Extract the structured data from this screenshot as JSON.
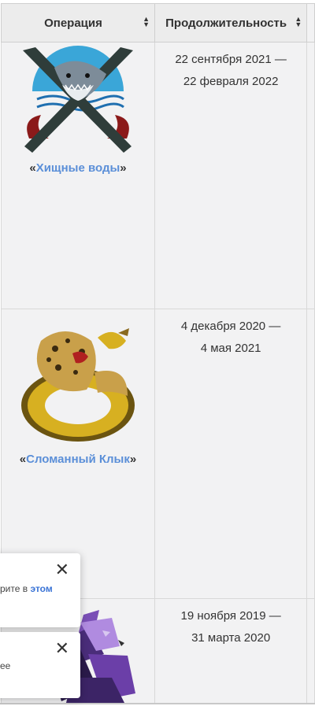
{
  "table": {
    "headers": [
      "Операция",
      "Продолжительность"
    ],
    "rows": [
      {
        "prefix": "«",
        "name": "Хищные воды",
        "suffix": "»",
        "duration_start": "22 сентября 2021 —",
        "duration_end": "22 февраля 2022",
        "icon": "shark-crossed-knives-emblem"
      },
      {
        "prefix": "«",
        "name": "Сломанный Клык",
        "suffix": "»",
        "duration_start": "4 декабря 2020 —",
        "duration_end": "4 мая 2021",
        "icon": "leopard-snake-emblem"
      },
      {
        "prefix": "",
        "name": "",
        "suffix": "",
        "duration_start": "19 ноября 2019 —",
        "duration_end": "31 марта 2020",
        "icon": "shattered-emblem"
      }
    ]
  },
  "toasts": [
    {
      "text": "рите в ",
      "link": "этом"
    },
    {
      "text": "ее",
      "link": ""
    }
  ],
  "colors": {
    "header_bg": "#ececec",
    "cell_bg": "#f2f2f3",
    "link": "#5b8fd8"
  }
}
